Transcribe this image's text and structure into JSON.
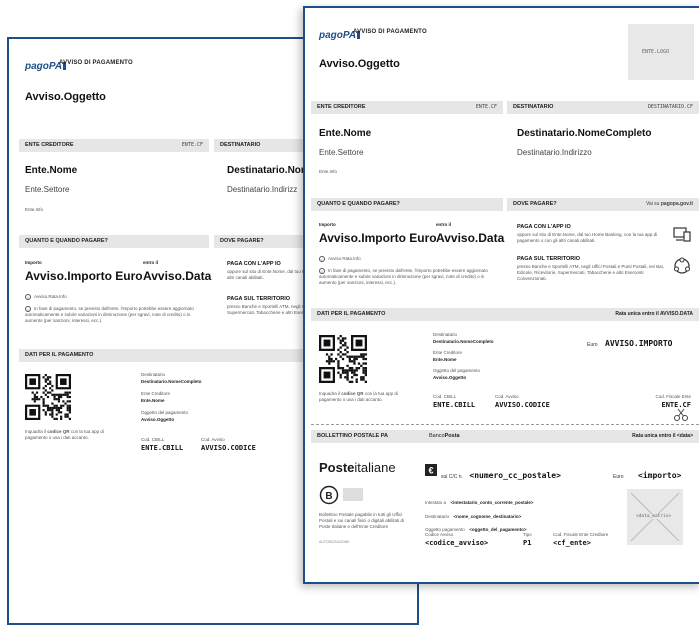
{
  "brand": {
    "logo_text": "pagoPA",
    "avviso_label": "AVVISO DI PAGAMENTO"
  },
  "doc": {
    "title": "Avviso.Oggetto",
    "ente_logo": "ENTE.LOGO",
    "sections": {
      "ente_creditore": "ENTE CREDITORE",
      "ente_cf": "ENTE.CF",
      "destinatario": "DESTINATARIO",
      "destinatario_cf": "DESTINATARIO.CF",
      "quando": "QUANTO E QUANDO PAGARE?",
      "dove": "DOVE PAGARE?",
      "dove_link_prefix": "Vai su",
      "dove_link": "pagopa.gov.it",
      "dati": "DATI PER IL PAGAMENTO",
      "rata_unica": "Rata unica entro il",
      "rata_unica_val": "AVVISO.DATA",
      "bollettino": "BOLLETTINO POSTALE PA",
      "banco": "Banco",
      "posta": "Posta",
      "rata_data": "Rata unica entro il <data>"
    },
    "ente": {
      "nome": "Ente.Nome",
      "settore": "Ente.Settore",
      "info": "Ente.Info"
    },
    "destinatario": {
      "nome": "Destinatario.NomeCompleto",
      "nome_short": "Destinatario.Nom",
      "indirizzo": "Destinatario.Indirizzo",
      "indirizzo_short": "Destinatario.Indirizz"
    },
    "importo": {
      "label": "Importo",
      "value": "Avviso.Importo Euro",
      "entro_label": "entro il",
      "data": "Avviso.Data"
    },
    "rata_info": "Avviso.Rata.Info",
    "nota": "In fase di pagamento, se previsto dall'ente, l'importo potrebbe essere aggiornato automaticamente e subire variazioni in diminuzione (per sgravi, note di credito) o in aumento (per sanzioni, interessi, ecc.).",
    "pay_app": {
      "title": "PAGA CON L'APP IO",
      "text": "oppure sul sito di Ente.Nome, dal tuo Home Banking, con la tua app di pagamento o con gli altri canali abilitati."
    },
    "pay_terr": {
      "title": "PAGA SUL TERRITORIO",
      "text": "presso Banche e Sportelli ATM, negli Uffici Postali e Punti Postali, nei Bar, Edicole, Ricevitorie, Supermercati, Tabaccherie e altri Esercenti Convenzionati."
    },
    "qr_hint_pre": "Inquadra il",
    "qr_hint_bold": "codice QR",
    "qr_hint_post": "con la tua app di pagamento o usa i dati accanto.",
    "dati": {
      "dest_label": "Destinatario",
      "dest_value": "Destinatario.NomeCompleto",
      "ente_label": "Ente Creditore",
      "ente_value": "Ente.Nome",
      "ogg_label": "Oggetto del pagamento",
      "ogg_value": "Avviso.Oggetto",
      "cbill_label": "Cod. CBILL",
      "cbill_value": "ENTE.CBILL",
      "codavv_label": "Cod. Avviso",
      "codavv_value": "AVVISO.CODICE",
      "cf_label": "Cod. Fiscale Ente",
      "cf_value": "ENTE.CF",
      "euro_label": "Euro",
      "importo_value": "AVVISO.IMPORTO"
    },
    "poste": {
      "brand_a": "Poste",
      "brand_b": "italiane",
      "cc_prefix": "sul C/C n.",
      "cc_value": "<numero_cc_postale>",
      "euro_label": "Euro",
      "importo": "<importo>",
      "intestato_label": "Intestato a",
      "intestato_value": "<intestatario_conto_corrente_postale>",
      "dest_label": "Destinatario",
      "dest_value": "<nome_cognome_destinatario>",
      "ogg_label": "Oggetto pagamento",
      "ogg_value": "<oggetto_del_pagamento>",
      "codavv_label": "Codice Avviso",
      "codavv_value": "<codice_avviso>",
      "tipo_label": "Tipo",
      "tipo_value": "P1",
      "cf_label": "Cod. Fiscale Ente Creditore",
      "cf_value": "<cf_ente>",
      "datamatrix": "<data_matrix>",
      "boll_text": "Bollettino Postale pagabile in tutti gli Uffici Postali e sui canali fisici o digitali abilitati di Poste Italiane e dell'Ente Creditore",
      "auth": "AUTORIZZAZIONE"
    }
  }
}
